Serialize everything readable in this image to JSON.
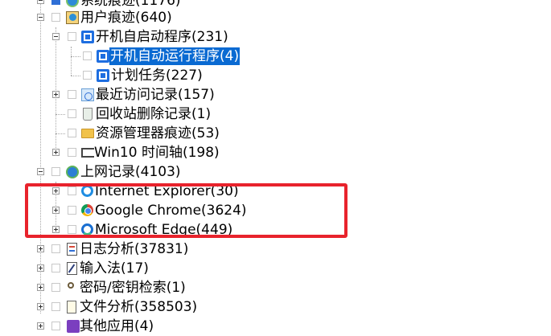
{
  "tree": {
    "items": [
      {
        "label": "系统痕迹(1176)",
        "icon": "system-trace-icon"
      },
      {
        "label": "用户痕迹(640)",
        "icon": "user-trace-icon"
      },
      {
        "label": "开机自启动程序(231)",
        "icon": "startup-programs-icon"
      },
      {
        "label": "开机自动运行程序(4)",
        "icon": "autorun-programs-icon",
        "selected": true
      },
      {
        "label": "计划任务(227)",
        "icon": "scheduled-tasks-icon"
      },
      {
        "label": "最近访问记录(157)",
        "icon": "recent-access-icon"
      },
      {
        "label": "回收站删除记录(1)",
        "icon": "recycle-bin-icon"
      },
      {
        "label": "资源管理器痕迹(53)",
        "icon": "folder-icon"
      },
      {
        "label": "Win10 时间轴(198)",
        "icon": "timeline-icon"
      },
      {
        "label": "上网记录(4103)",
        "icon": "globe-icon"
      },
      {
        "label": "Internet Explorer(30)",
        "icon": "internet-explorer-icon"
      },
      {
        "label": "Google Chrome(3624)",
        "icon": "chrome-icon"
      },
      {
        "label": "Microsoft Edge(449)",
        "icon": "edge-icon"
      },
      {
        "label": "日志分析(37831)",
        "icon": "log-analysis-icon"
      },
      {
        "label": "输入法(17)",
        "icon": "input-method-icon"
      },
      {
        "label": "密码/密钥检索(1)",
        "icon": "key-icon"
      },
      {
        "label": "文件分析(358503)",
        "icon": "file-analysis-icon"
      },
      {
        "label": "其他应用(4)",
        "icon": "other-apps-icon"
      }
    ]
  },
  "colors": {
    "selection": "#0a6ad2",
    "highlight_box": "#e8232c",
    "icon_blue": "#1e6ee0"
  }
}
